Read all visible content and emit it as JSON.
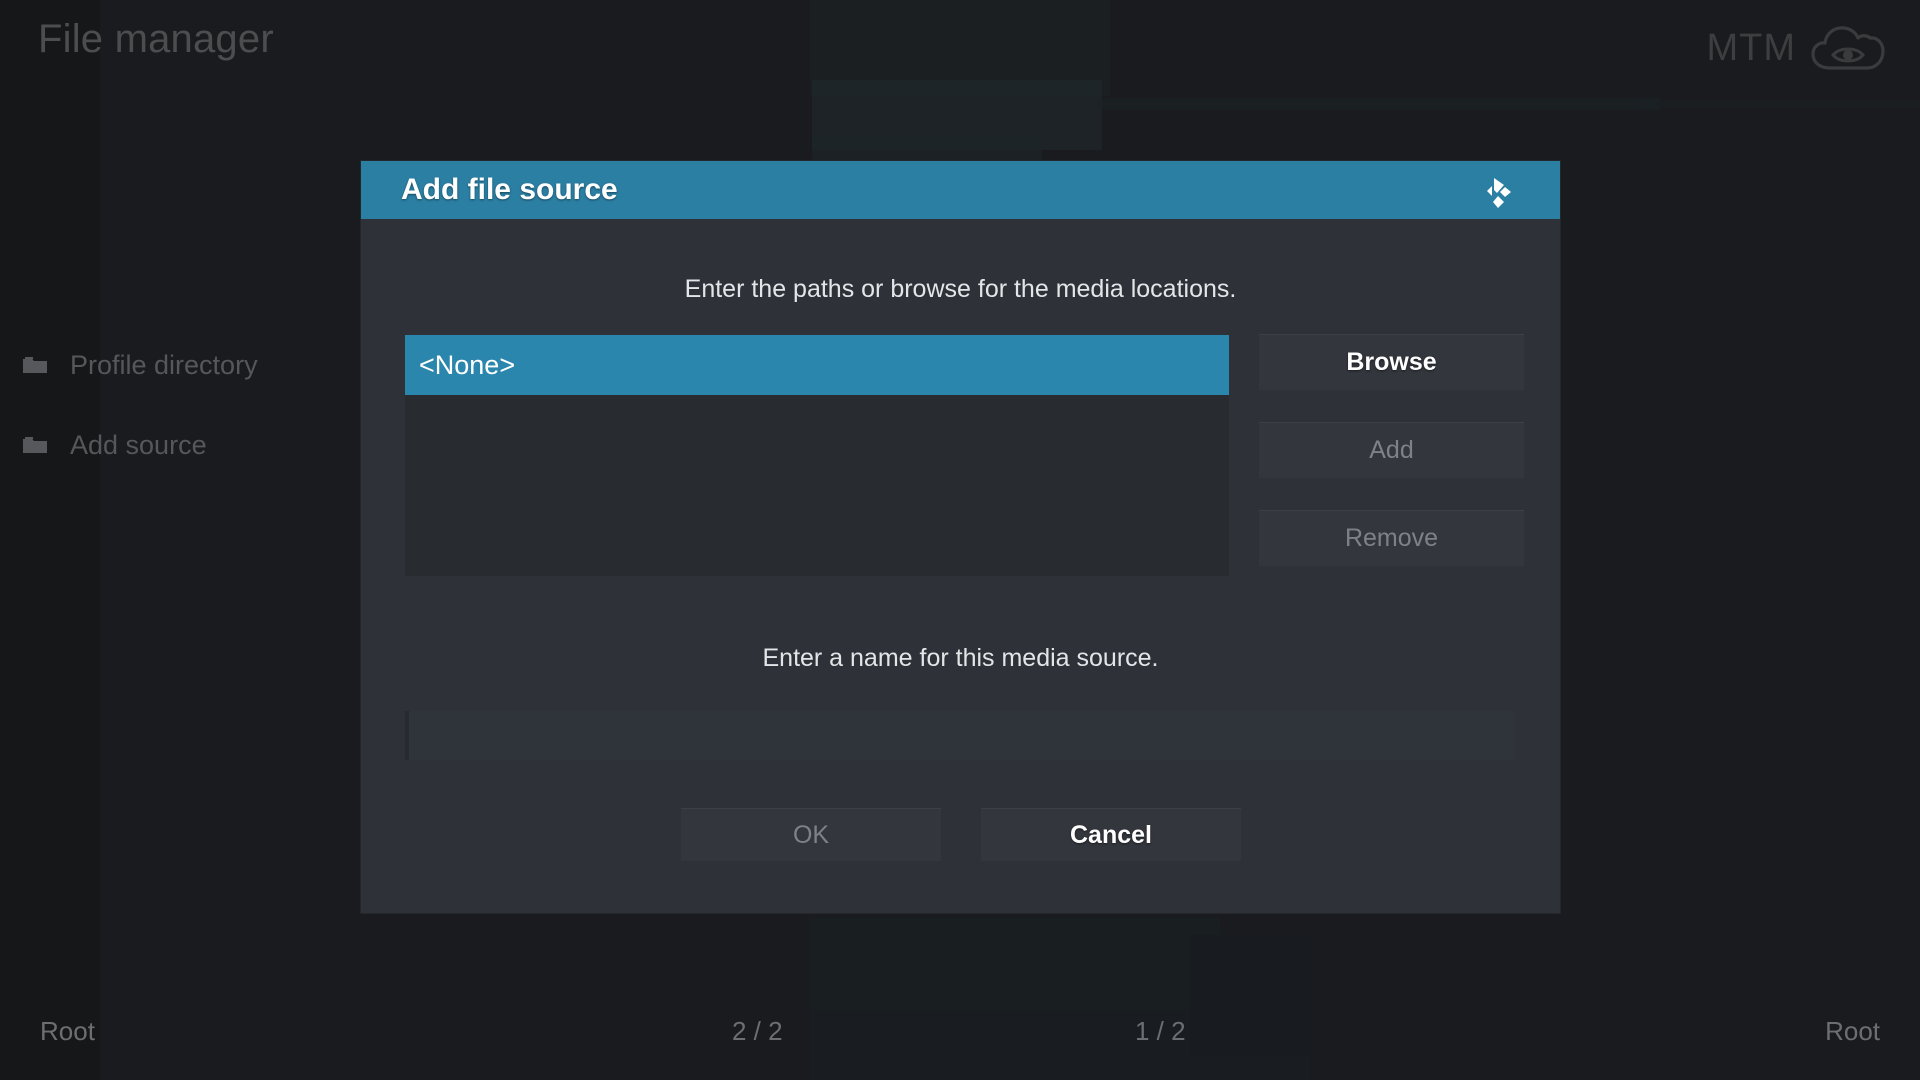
{
  "header": {
    "title": "File manager",
    "brand_text": "MTM",
    "brand_logo_icon": "cloud-eye-icon"
  },
  "sidebar": {
    "items": [
      {
        "label": "Profile directory",
        "icon": "folder-icon"
      },
      {
        "label": "Add source",
        "icon": "folder-icon"
      }
    ]
  },
  "statusbar": {
    "left_path": "Root",
    "left_count": "2 / 2",
    "right_count": "1 / 2",
    "right_path": "Root"
  },
  "dialog": {
    "title": "Add file source",
    "logo_icon": "kodi-logo-icon",
    "hint_paths": "Enter the paths or browse for the media locations.",
    "hint_name": "Enter a name for this media source.",
    "path_list": [
      {
        "label": "<None>",
        "selected": true
      }
    ],
    "side_buttons": [
      {
        "label": "Browse",
        "enabled": true
      },
      {
        "label": "Add",
        "enabled": false
      },
      {
        "label": "Remove",
        "enabled": false
      }
    ],
    "name_field": {
      "value": "",
      "placeholder": ""
    },
    "footer_buttons": [
      {
        "label": "OK",
        "enabled": false
      },
      {
        "label": "Cancel",
        "enabled": true
      }
    ]
  },
  "colors": {
    "accent": "#2b7fa3",
    "selection": "#2b86ad",
    "dialog_bg": "#2e3238",
    "list_bg": "#282c31",
    "button_bg": "#33373d",
    "page_bg": "#191b1e"
  }
}
